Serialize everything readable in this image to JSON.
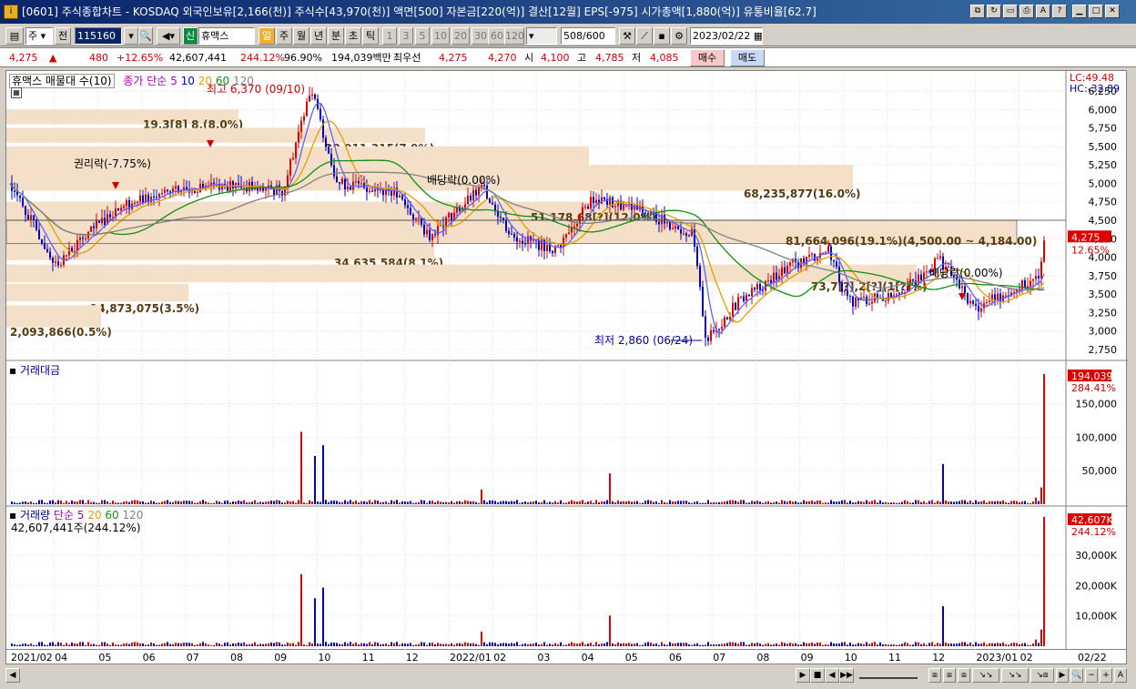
{
  "window": {
    "title": "[0601] 주식종합차트 - KOSDAQ 외국인보유[2,166(천)] 주식수[43,970(천)] 액면[500] 자본금[220(억)] 결산[12월] EPS[-975] 시가총액[1,880(억)] 유통비율[62.7]",
    "icon": "window-icon"
  },
  "toolbar": {
    "period": "주",
    "prev": "전",
    "code": "115160",
    "stock_badge": "신",
    "stock_name": "휴맥스",
    "day": "일",
    "week": "주",
    "month": "월",
    "year": "년",
    "minute": "분",
    "second": "초",
    "tick": "틱",
    "intervals": [
      "1",
      "3",
      "5",
      "10",
      "20",
      "30",
      "60",
      "120"
    ],
    "count": "508",
    "count_total": "/600",
    "date": "2023/02/22"
  },
  "quote": {
    "price": "4,275",
    "arrow": "▲",
    "change": "480",
    "change_pct": "+12.65%",
    "volume": "42,607,441",
    "vol_ratio": "244.12%",
    "strength": "96.90%",
    "amount": "194,039백만",
    "best_label": "최우선",
    "ask": "4,275",
    "bid": "4,270",
    "open_label": "시",
    "open": "4,100",
    "high_label": "고",
    "high": "4,785",
    "low_label": "저",
    "low": "4,085",
    "buy": "매수",
    "sell": "매도"
  },
  "price_pane": {
    "title": "휴맥스 매물대 수(10)",
    "ma_label": "종가 단순",
    "ma_periods": [
      "5",
      "10",
      "20",
      "60",
      "120"
    ],
    "lc": "LC:49.48",
    "hc": "HC:-32.89",
    "high_note": "최고 6,370 (09/10)",
    "low_note": "최저 2,860 (06/24)",
    "current_price": "4,275",
    "current_pct": "12.65%",
    "events": [
      "권리락(-7.75%)",
      "배당락(0.00%)",
      "배당락(0.00%)"
    ],
    "volume_profile": [
      "19,3[8] 8,(8.0%)",
      "28,911,315(7.9%)",
      "47,037,752(11.0%)",
      "68,235,877(16.0%)",
      "51,178,68[?](12.0%)",
      "81,664,096(19.1%)(4,500.00 ~ 4,184.00)",
      "34,635,584(8.1%)",
      "73,7[?],2[?](1[?]%)",
      "14,873,075(3.5%)",
      "2,093,866(0.5%)"
    ]
  },
  "amount_pane": {
    "title": "거래대금",
    "current": "194,039",
    "pct": "284.41%"
  },
  "volume_pane": {
    "title": "거래량",
    "ma_label": "단순",
    "ma_periods": [
      "5",
      "20",
      "60",
      "120"
    ],
    "sub": "42,607,441주(244.12%)",
    "current": "42,607K",
    "pct": "244.12%"
  },
  "axes": {
    "price_ticks": [
      "6,250",
      "6,000",
      "5,750",
      "5,500",
      "5,250",
      "5,000",
      "4,750",
      "4,500",
      "4,250",
      "4,000",
      "3,750",
      "3,500",
      "3,250",
      "3,000",
      "2,750"
    ],
    "amount_ticks": [
      "150,000",
      "100,000",
      "50,000"
    ],
    "volume_ticks": [
      "30,000K",
      "20,000K",
      "10,000K"
    ],
    "x_ticks": [
      "2021/02",
      "04",
      "05",
      "06",
      "07",
      "08",
      "09",
      "10",
      "11",
      "12",
      "2022/01",
      "02",
      "03",
      "04",
      "05",
      "06",
      "07",
      "08",
      "09",
      "10",
      "11",
      "12",
      "2023/01",
      "02"
    ],
    "x_right": "02/22"
  },
  "colors": {
    "up": "#e00000",
    "down": "#0000d0",
    "profile": "#f4e0c8",
    "ma5": "#6060ff",
    "ma20": "#e0a000",
    "ma60": "#109010",
    "ma120": "#808080"
  }
}
